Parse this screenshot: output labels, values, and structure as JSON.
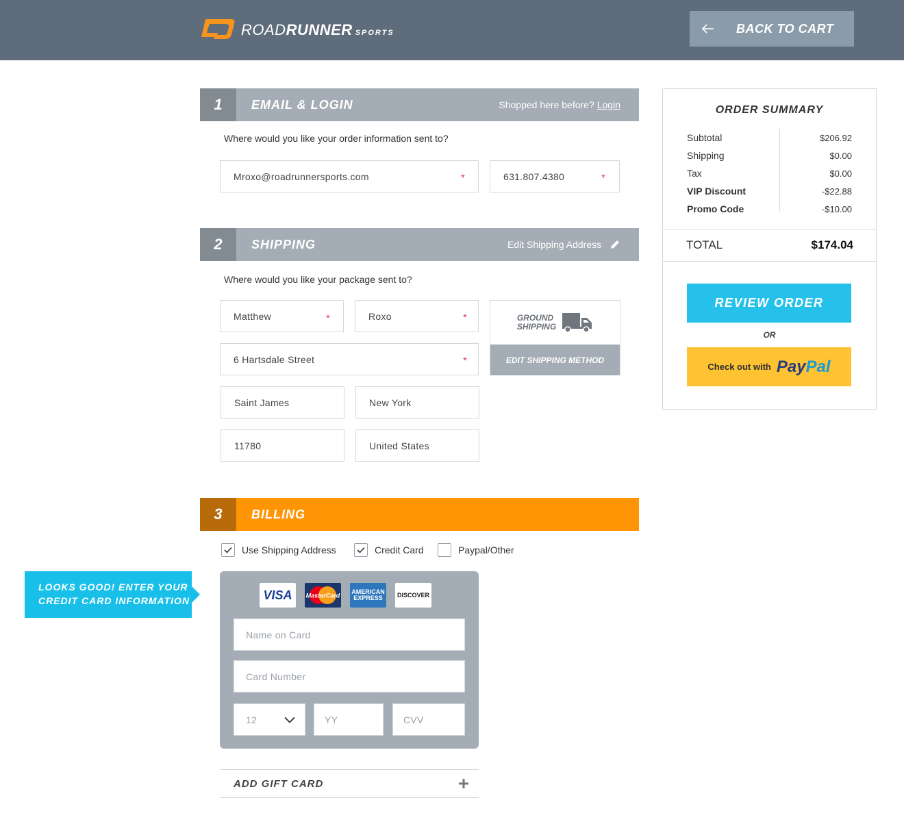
{
  "header": {
    "logo_road": "ROAD",
    "logo_runner": "RUNNER",
    "logo_sports": "SPORTS",
    "back_label": "BACK TO CART"
  },
  "email_section": {
    "number": "1",
    "title": "EMAIL & LOGIN",
    "shopped_text": "Shopped here before?",
    "login_link": "Login",
    "prompt": "Where would you like your order information sent to?",
    "email_value": "Mroxo@roadrunnersports.com",
    "phone_value": "631.807.4380",
    "required_mark": "*"
  },
  "shipping_section": {
    "number": "2",
    "title": "SHIPPING",
    "edit_label": "Edit Shipping Address",
    "prompt": "Where would you like your package sent to?",
    "first_name": "Matthew",
    "last_name": "Roxo",
    "street": "6 Hartsdale Street",
    "city": "Saint James",
    "state": "New York",
    "zip": "11780",
    "country": "United States",
    "method_line1": "GROUND",
    "method_line2": "SHIPPING",
    "edit_method_label": "EDIT SHIPPING METHOD"
  },
  "billing_section": {
    "number": "3",
    "title": "BILLING",
    "options": [
      {
        "label": "Use Shipping Address",
        "checked": true
      },
      {
        "label": "Credit Card",
        "checked": true
      },
      {
        "label": "Paypal/Other",
        "checked": false
      }
    ],
    "callout_line1": "LOOKS GOOD! ENTER YOUR",
    "callout_line2": "CREDIT CARD INFORMATION",
    "card_brands": {
      "visa": "VISA",
      "mastercard": "MasterCard",
      "amex_line1": "AMERICAN",
      "amex_line2": "EXPRESS",
      "discover": "DISCOVER"
    },
    "name_placeholder": "Name on Card",
    "number_placeholder": "Card Number",
    "month_value": "12",
    "year_placeholder": "YY",
    "cvv_placeholder": "CVV",
    "gift_label": "ADD GIFT CARD"
  },
  "summary": {
    "title": "ORDER SUMMARY",
    "rows": [
      {
        "label": "Subtotal",
        "value": "$206.92"
      },
      {
        "label": "Shipping",
        "value": "$0.00"
      },
      {
        "label": "Tax",
        "value": "$0.00"
      },
      {
        "label": "VIP Discount",
        "value": "-$22.88"
      },
      {
        "label": "Promo Code",
        "value": "-$10.00"
      }
    ],
    "total_label": "TOTAL",
    "total_value": "$174.04",
    "review_label": "REVIEW ORDER",
    "or_label": "OR",
    "paypal_prefix": "Check out with",
    "paypal_brand_1": "Pay",
    "paypal_brand_2": "Pal"
  },
  "colors": {
    "header_bg": "#5e6c7b",
    "section_gray": "#a4adb5",
    "billing_orange": "#ff9505",
    "accent_blue": "#25c1ea",
    "required_pink": "#e0247c",
    "paypal_yellow": "#ffc232"
  }
}
